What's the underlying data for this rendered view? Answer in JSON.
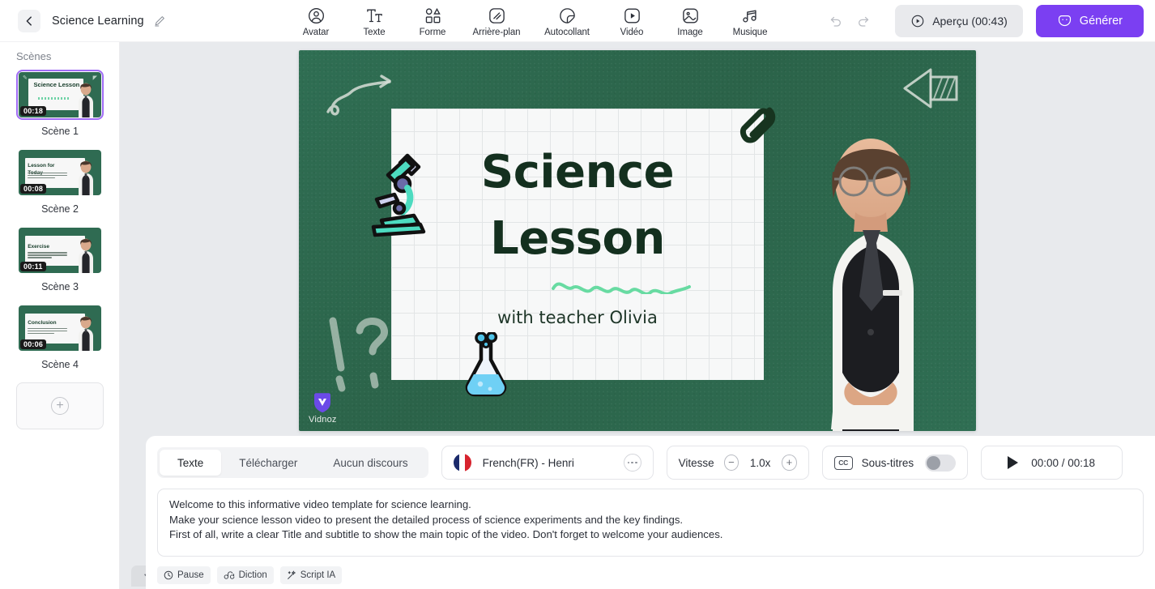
{
  "topbar": {
    "back_icon": "chevron-left-icon",
    "project_title": "Science Learning",
    "edit_icon": "pencil-icon",
    "tools": [
      {
        "label": "Avatar",
        "icon": "avatar-icon"
      },
      {
        "label": "Texte",
        "icon": "text-icon"
      },
      {
        "label": "Forme",
        "icon": "shape-icon"
      },
      {
        "label": "Arrière-plan",
        "icon": "background-icon"
      },
      {
        "label": "Autocollant",
        "icon": "sticker-icon"
      },
      {
        "label": "Vidéo",
        "icon": "video-icon"
      },
      {
        "label": "Image",
        "icon": "image-icon"
      },
      {
        "label": "Musique",
        "icon": "music-icon"
      }
    ],
    "undo_icon": "undo-icon",
    "redo_icon": "redo-icon",
    "preview_label": "Aperçu (00:43)",
    "preview_icon": "play-circle-icon",
    "generate_label": "Générer",
    "generate_icon": "sparkle-chat-icon",
    "accent_color": "#7b3ff2"
  },
  "sidebar": {
    "title": "Scènes",
    "scenes": [
      {
        "label": "Scène 1",
        "duration": "00:18",
        "board_title": "Science Lesson",
        "selected": true
      },
      {
        "label": "Scène 2",
        "duration": "00:08",
        "board_title": "Lesson for Today",
        "selected": false
      },
      {
        "label": "Scène 3",
        "duration": "00:11",
        "board_title": "Exercise",
        "selected": false
      },
      {
        "label": "Scène 4",
        "duration": "00:06",
        "board_title": "Conclusion",
        "selected": false
      }
    ],
    "add_scene_icon": "plus-icon"
  },
  "canvas": {
    "title_line1": "Science",
    "title_line2": "Lesson",
    "subtitle": "with teacher Olivia",
    "watermark": "Vidnoz",
    "board_color": "#2f6e53",
    "title_color": "#14301f",
    "stickers": [
      "microscope-sticker",
      "flask-sticker",
      "paperclip-sticker",
      "chalk-arrow-sticker",
      "chalk-swirl-arrow",
      "chalk-question-mark"
    ],
    "collapse_icon": "chevron-down-icon"
  },
  "bottom": {
    "tabs": [
      {
        "label": "Texte",
        "active": true
      },
      {
        "label": "Télécharger",
        "active": false
      },
      {
        "label": "Aucun discours",
        "active": false
      }
    ],
    "voice": {
      "name": "French(FR) - Henri",
      "flag": "france-flag-icon",
      "more_icon": "more-options-icon"
    },
    "speed": {
      "label": "Vitesse",
      "value": "1.0x",
      "minus_icon": "minus-circle-icon",
      "plus_icon": "plus-circle-icon"
    },
    "subtitles": {
      "icon": "cc-icon",
      "label": "Sous-titres",
      "enabled": false
    },
    "player": {
      "play_icon": "play-icon",
      "time": "00:00 / 00:18"
    },
    "script_lines": [
      "Welcome to this informative video template for science learning.",
      "Make your science lesson video to present the detailed process of science experiments and the key findings.",
      "First of all, write a clear Title and subtitle to show the main topic of the video. Don't forget to welcome your audiences."
    ],
    "chips": [
      {
        "label": "Pause",
        "icon": "clock-icon"
      },
      {
        "label": "Diction",
        "icon": "diction-icon"
      },
      {
        "label": "Script IA",
        "icon": "magic-wand-icon"
      }
    ]
  }
}
